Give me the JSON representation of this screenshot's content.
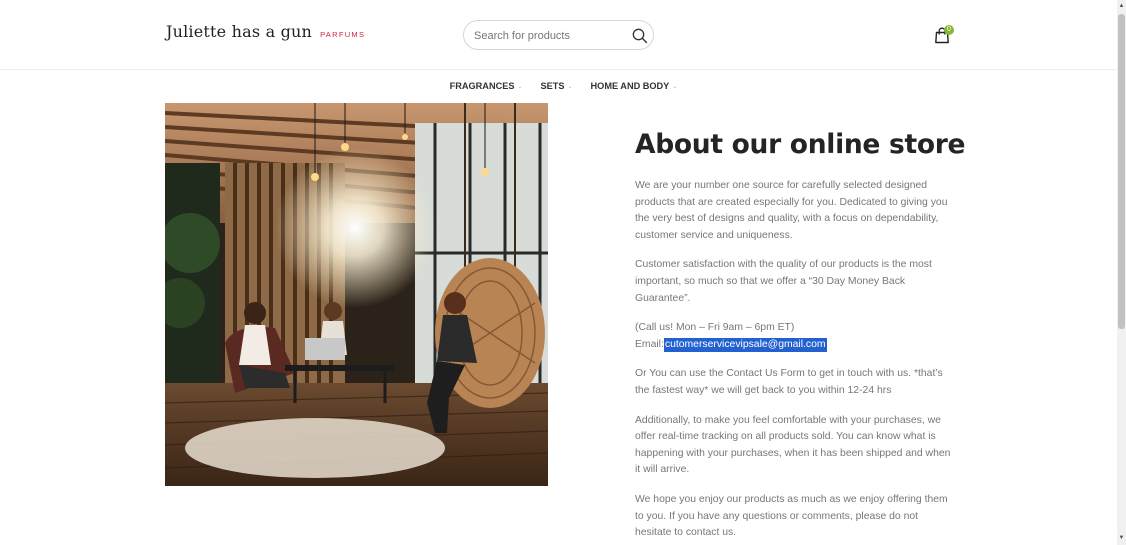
{
  "header": {
    "logo_text": "Juliette has a gun",
    "logo_subtext": "PARFUMS",
    "search_placeholder": "Search for products",
    "cart_count": "0"
  },
  "nav": {
    "items": [
      {
        "label": "FRAGRANCES"
      },
      {
        "label": "SETS"
      },
      {
        "label": "HOME AND BODY"
      }
    ]
  },
  "hero_image": {
    "description_icon": "photo-lounge-women-chatting"
  },
  "main": {
    "title": "About our online store",
    "p1": "We are your number one source for carefully selected designed products that are created especially for you. Dedicated to giving you the very best of designs and quality, with a focus on dependability, customer service and uniqueness.",
    "p2": "Customer satisfaction with the quality of our products is the most important, so much so that we offer a “30 Day Money Back Guarantee”.",
    "call_line": "(Call us! Mon – Fri 9am – 6pm ET)",
    "email_label": "Email:",
    "email": "cutomerservicevipsale@gmail.com",
    "p4": "Or You can use the Contact Us Form to get in touch with us. *that’s the fastest way* we will get back to you within 12-24 hrs",
    "p5": "Additionally, to make you feel comfortable with your purchases, we offer real-time tracking on all products sold. You can know what is happening with your purchases, when it has been shipped and when it will arrive.",
    "p6": "We hope you enjoy our products as much as we enjoy offering them to you. If you have any questions or comments, please do not hesitate to contact us."
  },
  "colors": {
    "accent_red": "#d0243a",
    "badge_green": "#83b735",
    "selection_blue": "#2461d0",
    "heading": "#242424",
    "body_text": "#777777"
  }
}
